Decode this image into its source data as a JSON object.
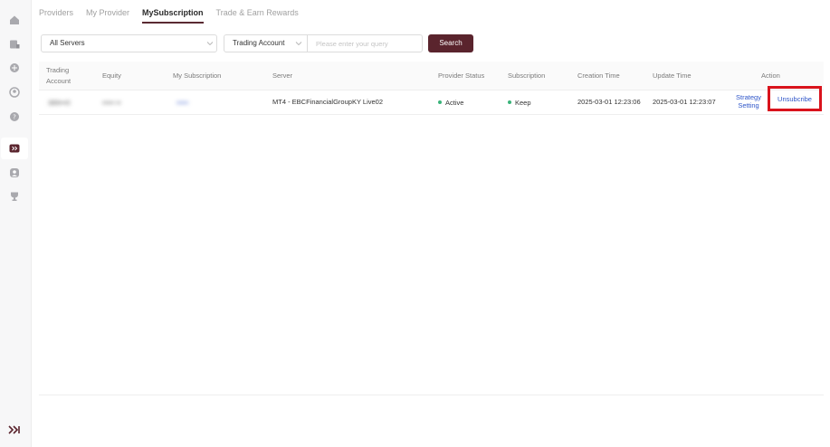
{
  "sidebar": {
    "icons": [
      "home-icon",
      "book-icon",
      "box-icon",
      "user-icon",
      "help-icon",
      "copy-trading-icon",
      "profile-icon",
      "trophy-icon"
    ],
    "active_index": 5,
    "bottom_icon": "expand-icon"
  },
  "tabs": [
    {
      "label": "Providers"
    },
    {
      "label": "My Provider"
    },
    {
      "label": "MySubscription"
    },
    {
      "label": "Trade & Earn Rewards"
    }
  ],
  "active_tab": 2,
  "filters": {
    "server_select": "All Servers",
    "account_select": "Trading Account",
    "query_placeholder": "Please enter your query",
    "search_label": "Search"
  },
  "table": {
    "columns": {
      "trading_account_1": "Trading",
      "trading_account_2": "Account",
      "equity": "Equity",
      "my_subscription": "My Subscription",
      "server": "Server",
      "provider_status": "Provider Status",
      "subscription": "Subscription",
      "creation_time": "Creation Time",
      "update_time": "Update Time",
      "action": "Action"
    },
    "row": {
      "trading_account": "389•••0",
      "equity": "••••• ••",
      "my_subscription": "•••••",
      "server": "MT4 - EBCFinancialGroupKY Live02",
      "provider_status": "Active",
      "subscription": "Keep",
      "creation_time": "2025-03-01 12:23:06",
      "update_time": "2025-03-01 12:23:07",
      "strategy_1": "Strategy",
      "strategy_2": "Setting",
      "unsubscribe": "Unsubcribe"
    }
  },
  "colors": {
    "accent": "#5a242d",
    "link": "#2f56c9",
    "status_green": "#3ab37a",
    "highlight": "#d9131c"
  }
}
